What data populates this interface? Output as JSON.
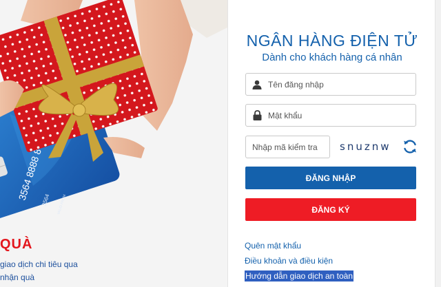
{
  "promo": {
    "title": "QUÀ",
    "line1": "giao dịch chi tiêu qua",
    "line2": "nhận quà",
    "card_number": "3564 8888 8",
    "card_number_small": "3564",
    "card_valid_label": "VALID FROM",
    "colors": {
      "gift_box": "#d4171d",
      "ribbon": "#c9a43a",
      "card": "#1a5fb4"
    }
  },
  "panel": {
    "title": "NGÂN HÀNG ĐIỆN TỬ",
    "subtitle": "Dành cho khách hàng cá nhân",
    "username": {
      "placeholder": "Tên đăng nhập",
      "value": ""
    },
    "password": {
      "placeholder": "Mật khẩu",
      "value": ""
    },
    "captcha": {
      "placeholder": "Nhập mã kiểm tra",
      "value": "",
      "code": "snuznw"
    },
    "login_button": "ĐĂNG NHẬP",
    "register_button": "ĐĂNG KÝ",
    "links": {
      "forgot_password": "Quên mật khẩu",
      "terms": "Điều khoản và điều kiện",
      "safety_guide": "Hướng dẫn giao dịch an toàn"
    },
    "colors": {
      "primary": "#1461ac",
      "danger": "#ee1c25"
    }
  }
}
